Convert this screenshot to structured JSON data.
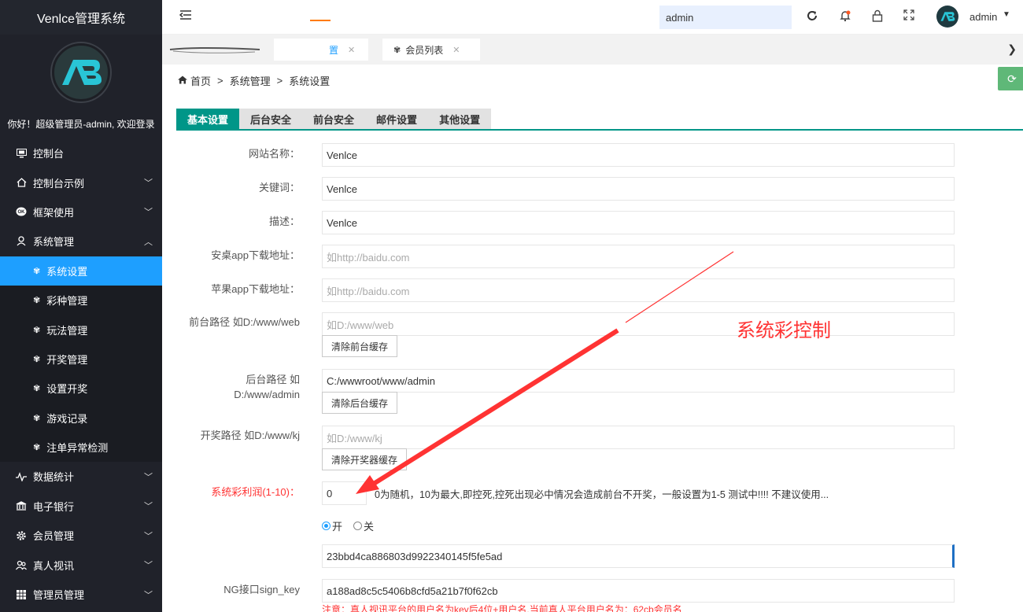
{
  "app": {
    "title": "Venlce管理系统",
    "welcome": "你好！超级管理员-admin, 欢迎登录"
  },
  "sidebar": {
    "items": [
      {
        "label": "控制台",
        "icon": "monitor-icon",
        "expandable": false
      },
      {
        "label": "控制台示例",
        "icon": "home-icon",
        "expandable": true
      },
      {
        "label": "框架使用",
        "icon": "ok-icon",
        "expandable": true
      },
      {
        "label": "系统管理",
        "icon": "user-icon",
        "expandable": true,
        "expanded": true
      }
    ],
    "sub_items": [
      {
        "label": "系统设置",
        "active": true
      },
      {
        "label": "彩种管理"
      },
      {
        "label": "玩法管理"
      },
      {
        "label": "开奖管理"
      },
      {
        "label": "设置开奖"
      },
      {
        "label": "游戏记录"
      },
      {
        "label": "注单异常检测"
      }
    ],
    "items_after": [
      {
        "label": "数据统计",
        "icon": "chart-icon"
      },
      {
        "label": "电子银行",
        "icon": "bank-icon"
      },
      {
        "label": "会员管理",
        "icon": "gear-icon"
      },
      {
        "label": "真人视讯",
        "icon": "people-icon"
      },
      {
        "label": "管理员管理",
        "icon": "grid-icon"
      }
    ]
  },
  "header": {
    "search_value": "admin",
    "user_name": "admin"
  },
  "tabs": [
    {
      "label": "置"
    },
    {
      "label": "会员列表"
    }
  ],
  "breadcrumb": {
    "home": "首页",
    "sep": ">",
    "level1": "系统管理",
    "level2": "系统设置"
  },
  "settings_tabs": [
    "基本设置",
    "后台安全",
    "前台安全",
    "邮件设置",
    "其他设置"
  ],
  "form": {
    "site_name": {
      "label": "网站名称：",
      "value": "Venlce"
    },
    "keywords": {
      "label": "关键词：",
      "value": "Venlce"
    },
    "description": {
      "label": "描述：",
      "value": "Venlce"
    },
    "android_url": {
      "label": "安桌app下载地址：",
      "placeholder": "如http://baidu.com"
    },
    "apple_url": {
      "label": "苹果app下载地址：",
      "placeholder": "如http://baidu.com"
    },
    "front_path": {
      "label": "前台路径 如D:/www/web",
      "placeholder": "如D:/www/web",
      "button": "清除前台缓存"
    },
    "admin_path": {
      "label_line1": "后台路径 如",
      "label_line2": "D:/www/admin",
      "value": "C:/wwwroot/www/admin",
      "button": "清除后台缓存"
    },
    "lottery_path": {
      "label": "开奖路径 如D:/www/kj",
      "placeholder": "如D:/www/kj",
      "button": "清除开奖器缓存"
    },
    "profit": {
      "label": "系统彩利润(1-10)：",
      "value": "0",
      "desc": "0为随机，10为最大,即控死,控死出现必中情况会造成前台不开奖，一般设置为1-5 测试中!!!! 不建议使用..."
    },
    "switch": {
      "on": "开",
      "off": "关",
      "selected": "on"
    },
    "hash": {
      "value": "23bbd4ca886803d9922340145f5fe5ad"
    },
    "ng_key": {
      "label": "NG接口sign_key",
      "value": "a188ad8c5c5406b8cfd5a21b7f0f62cb"
    },
    "note": "注意：真人视讯平台的用户名为key后4位+用户名,当前真人平台用户名为：62cb会员名"
  },
  "annotation": {
    "text": "系统彩控制"
  },
  "colors": {
    "sidebar_bg": "#20222a",
    "active_blue": "#1e9fff",
    "tab_green": "#009688",
    "annotation_red": "#ff3333"
  }
}
